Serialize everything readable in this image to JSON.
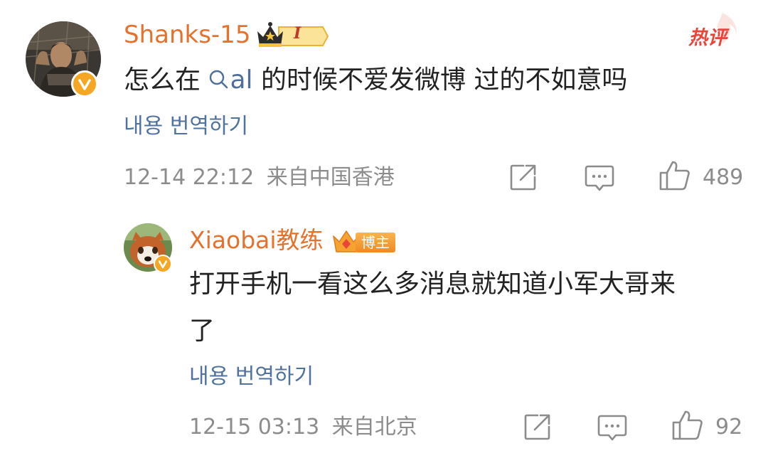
{
  "comment": {
    "username": "Shanks-15",
    "level_badge": "I",
    "hot_tag": "热评",
    "text_before": "怎么在",
    "search_link": "al",
    "text_after": "的时候不爱发微博 过的不如意吗",
    "translate": "내용 번역하기",
    "timestamp": "12-14 22:12",
    "location": "来自中国香港",
    "likes": "489"
  },
  "reply": {
    "username": "Xiaobai教练",
    "role_badge": "博主",
    "text_line1": "打开手机一看这么多消息就知道小军大哥来",
    "text_line2": "了",
    "translate": "내용 번역하기",
    "timestamp": "12-15 03:13",
    "location": "来自北京",
    "likes": "92"
  },
  "colors": {
    "username": "#e4722d",
    "link": "#4d6f99",
    "translate": "#50729f",
    "meta": "#8c8c8c",
    "verified": "#f5a623",
    "hot": "#e8463a"
  },
  "icons": [
    "verified-icon",
    "crown-level-icon",
    "hot-comment-icon",
    "search-icon",
    "share-icon",
    "comment-icon",
    "like-icon",
    "crown-icon"
  ]
}
